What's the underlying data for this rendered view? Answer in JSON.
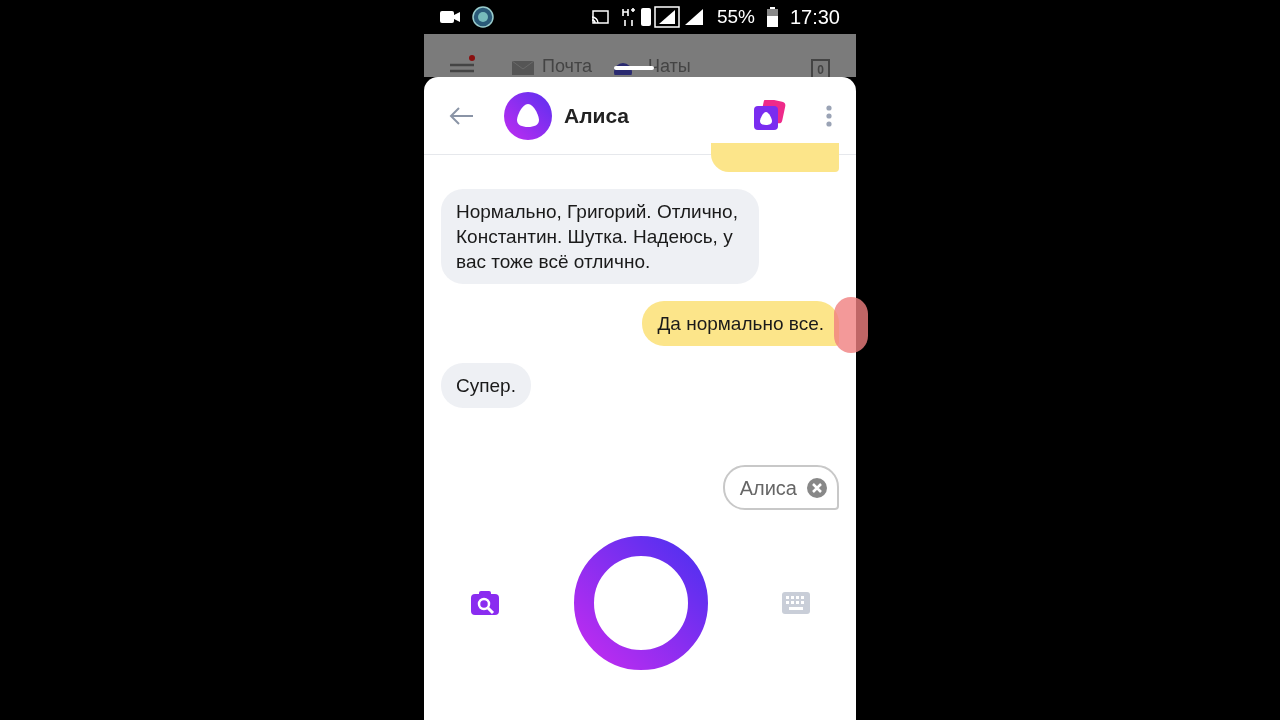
{
  "status_bar": {
    "battery": "55%",
    "time": "17:30"
  },
  "background_app": {
    "tabs": [
      {
        "label": "Почта"
      },
      {
        "label": "Чаты"
      }
    ],
    "counter": "0"
  },
  "header": {
    "title": "Алиса"
  },
  "messages": [
    {
      "kind": "partial"
    },
    {
      "kind": "incoming",
      "text": "Нормально, Григорий. Отлично, Константин. Шутка. Надеюсь, у вас тоже всё отлично."
    },
    {
      "kind": "outgoing",
      "text": "Да нормально все."
    },
    {
      "kind": "incoming",
      "text": "Супер."
    }
  ],
  "suggestion": {
    "label": "Алиса"
  }
}
